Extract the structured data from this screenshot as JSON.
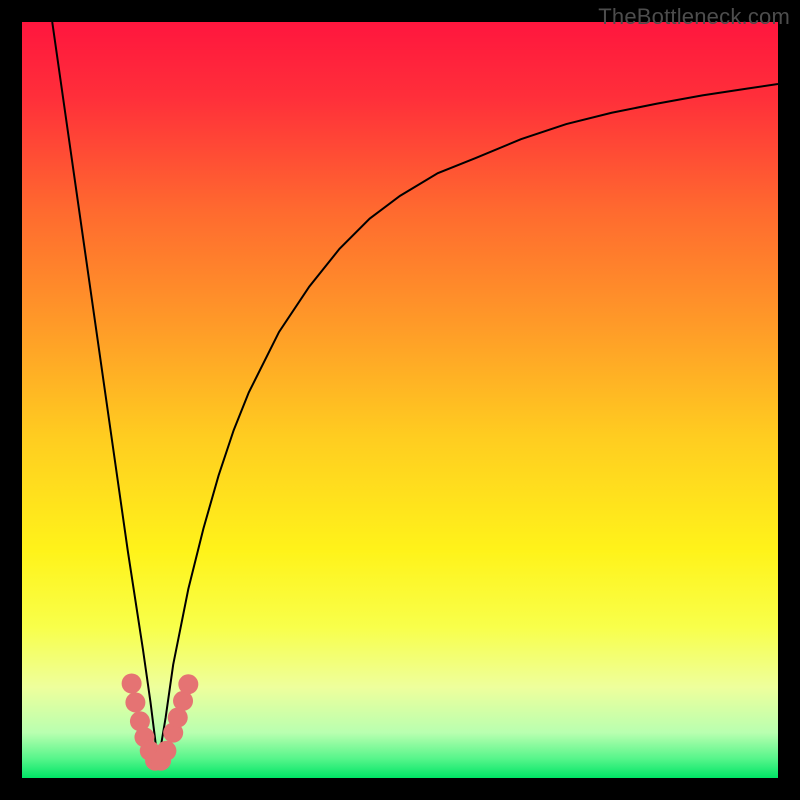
{
  "watermark": "TheBottleneck.com",
  "gradient_stops": [
    {
      "offset": 0.0,
      "color": "#ff163e"
    },
    {
      "offset": 0.1,
      "color": "#ff2f3a"
    },
    {
      "offset": 0.25,
      "color": "#ff6a2f"
    },
    {
      "offset": 0.4,
      "color": "#ff9a28"
    },
    {
      "offset": 0.55,
      "color": "#ffcd20"
    },
    {
      "offset": 0.7,
      "color": "#fff31a"
    },
    {
      "offset": 0.8,
      "color": "#f8ff4a"
    },
    {
      "offset": 0.88,
      "color": "#eeff9c"
    },
    {
      "offset": 0.94,
      "color": "#b9ffb0"
    },
    {
      "offset": 0.975,
      "color": "#55f58a"
    },
    {
      "offset": 1.0,
      "color": "#00e565"
    }
  ],
  "chart_data": {
    "type": "line",
    "title": "",
    "xlabel": "",
    "ylabel": "",
    "xlim": [
      0,
      100
    ],
    "ylim": [
      0,
      100
    ],
    "grid": false,
    "legend": false,
    "optimum_x": 18,
    "series": [
      {
        "name": "bottleneck-curve",
        "x": [
          4,
          6,
          8,
          10,
          12,
          14,
          16,
          17,
          18,
          19,
          20,
          22,
          24,
          26,
          28,
          30,
          34,
          38,
          42,
          46,
          50,
          55,
          60,
          66,
          72,
          78,
          84,
          90,
          96,
          100
        ],
        "y": [
          100,
          86,
          72,
          58,
          44,
          30,
          17,
          10,
          2,
          8,
          15,
          25,
          33,
          40,
          46,
          51,
          59,
          65,
          70,
          74,
          77,
          80,
          82,
          84.5,
          86.5,
          88,
          89.2,
          90.3,
          91.2,
          91.8
        ]
      }
    ],
    "markers": [
      {
        "name": "left-cluster",
        "color": "#e57373",
        "points": [
          {
            "x": 14.5,
            "y": 12.5
          },
          {
            "x": 15.0,
            "y": 10.0
          },
          {
            "x": 15.6,
            "y": 7.5
          },
          {
            "x": 16.2,
            "y": 5.4
          },
          {
            "x": 16.9,
            "y": 3.6
          },
          {
            "x": 17.6,
            "y": 2.3
          },
          {
            "x": 18.4,
            "y": 2.3
          },
          {
            "x": 19.1,
            "y": 3.6
          }
        ]
      },
      {
        "name": "right-cluster",
        "color": "#e57373",
        "points": [
          {
            "x": 20.0,
            "y": 6.0
          },
          {
            "x": 20.6,
            "y": 8.0
          },
          {
            "x": 21.3,
            "y": 10.2
          },
          {
            "x": 22.0,
            "y": 12.4
          }
        ]
      }
    ]
  }
}
